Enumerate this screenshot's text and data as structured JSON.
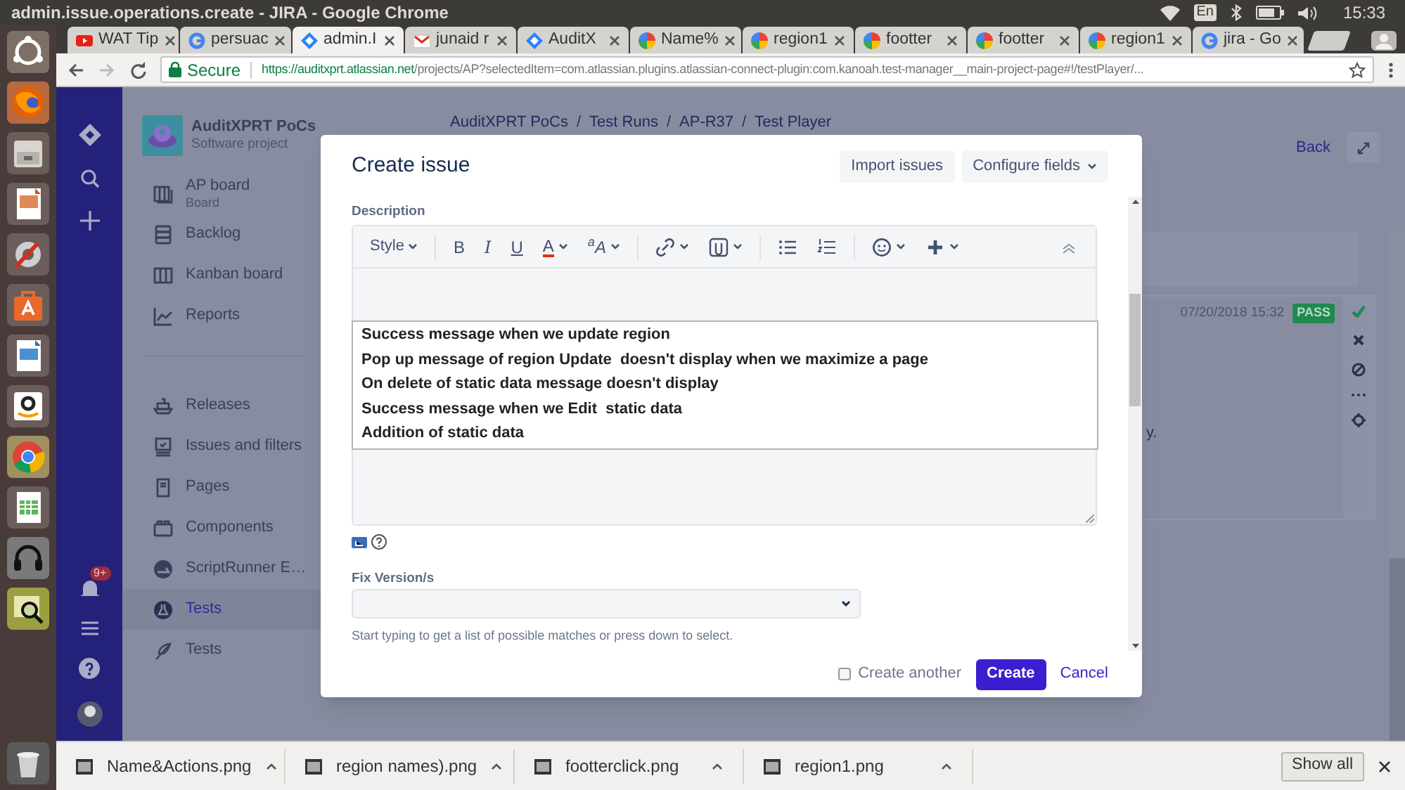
{
  "window": {
    "title": "admin.issue.operations.create - JIRA - Google Chrome"
  },
  "system_tray": {
    "language": "En",
    "time": "15:33"
  },
  "launcher": [
    {
      "kind": "ubuntu"
    },
    {
      "kind": "firefox"
    },
    {
      "kind": "files"
    },
    {
      "kind": "impress"
    },
    {
      "kind": "settings"
    },
    {
      "kind": "software"
    },
    {
      "kind": "writer"
    },
    {
      "kind": "amazon"
    },
    {
      "kind": "chrome"
    },
    {
      "kind": "calc"
    },
    {
      "kind": "headphones"
    },
    {
      "kind": "viewer"
    },
    {
      "kind": "trash"
    }
  ],
  "browser": {
    "tabs": [
      {
        "title": "WAT Tip",
        "kind": "video",
        "selected": false
      },
      {
        "title": "persuac",
        "kind": "search",
        "selected": false
      },
      {
        "title": "admin.I",
        "kind": "jira",
        "selected": true
      },
      {
        "title": "junaid r",
        "kind": "mail",
        "selected": false
      },
      {
        "title": "AuditX",
        "kind": "jira",
        "selected": false
      },
      {
        "title": "Name%",
        "kind": "drive",
        "selected": false
      },
      {
        "title": "region1",
        "kind": "drive",
        "selected": false
      },
      {
        "title": "footter",
        "kind": "drive",
        "selected": false
      },
      {
        "title": "footter",
        "kind": "drive",
        "selected": false
      },
      {
        "title": "region1",
        "kind": "drive",
        "selected": false
      },
      {
        "title": "jira - Go",
        "kind": "search",
        "selected": false
      }
    ],
    "address": {
      "secure_label": "Secure",
      "url_host": "https://auditxprt.atlassian.net",
      "url_path": "/projects/AP?selectedItem=com.atlassian.plugins.atlassian-connect-plugin:com.kanoah.test-manager__main-project-page#!/testPlayer/..."
    }
  },
  "jira": {
    "notification_badge": "9+",
    "project": {
      "name": "AuditXPRT PoCs",
      "type": "Software project"
    },
    "nav_groups": [
      {
        "items": [
          {
            "label": "AP board",
            "sublabel": "Board",
            "kind": "board",
            "selected": false
          },
          {
            "label": "Backlog",
            "kind": "backlog",
            "selected": false
          },
          {
            "label": "Kanban board",
            "kind": "columns",
            "selected": false
          },
          {
            "label": "Reports",
            "kind": "chart",
            "selected": false
          }
        ]
      },
      {
        "items": [
          {
            "label": "Releases",
            "kind": "ship",
            "selected": false
          },
          {
            "label": "Issues and filters",
            "kind": "monitor",
            "selected": false
          },
          {
            "label": "Pages",
            "kind": "page",
            "selected": false
          },
          {
            "label": "Components",
            "kind": "components",
            "selected": false
          },
          {
            "label": "ScriptRunner E…",
            "kind": "runner",
            "selected": false
          },
          {
            "label": "Tests",
            "kind": "flask",
            "selected": true
          },
          {
            "label": "Tests",
            "kind": "feather",
            "selected": false
          }
        ]
      }
    ],
    "breadcrumbs": [
      {
        "kind": "link",
        "text": "AuditXPRT PoCs"
      },
      {
        "kind": "separator",
        "text": "/"
      },
      {
        "kind": "link",
        "text": "Test Runs"
      },
      {
        "kind": "separator",
        "text": "/"
      },
      {
        "kind": "link",
        "text": "AP-R37"
      },
      {
        "kind": "separator",
        "text": "/"
      },
      {
        "kind": "link",
        "text": "Test Player"
      }
    ],
    "back_link": "Back",
    "test_result": {
      "timestamp": "07/20/2018 15:32",
      "status": "PASS",
      "text_fragment": "y."
    }
  },
  "dialog": {
    "title": "Create issue",
    "header_buttons": [
      {
        "label": "Import issues",
        "dropdown": false
      },
      {
        "label": "Configure fields",
        "dropdown": true
      }
    ],
    "description": {
      "label": "Description",
      "toolbar": [
        {
          "kind": "style",
          "label": "Style",
          "dropdown": true
        },
        {
          "kind": "separator"
        },
        {
          "kind": "bold",
          "label": "B",
          "dropdown": false
        },
        {
          "kind": "italic",
          "label": "I",
          "dropdown": false
        },
        {
          "kind": "underline",
          "label": "U",
          "dropdown": false
        },
        {
          "kind": "color",
          "label": "A",
          "dropdown": true
        },
        {
          "kind": "text_size",
          "label": "$^{a}$A",
          "dropdown": true
        },
        {
          "kind": "separator"
        },
        {
          "kind": "link",
          "dropdown": true
        },
        {
          "kind": "attachment",
          "dropdown": true
        },
        {
          "kind": "separator"
        },
        {
          "kind": "bullet_list",
          "dropdown": false
        },
        {
          "kind": "numbered_list",
          "dropdown": false
        },
        {
          "kind": "separator"
        },
        {
          "kind": "emoji",
          "dropdown": true
        },
        {
          "kind": "insert",
          "dropdown": true
        },
        {
          "kind": "collapse",
          "dropdown": false
        }
      ],
      "suggestions": [
        "Success message when we update region",
        "Pop up message of region Update  doesn't display when we maximize a page",
        "On delete of static data message doesn't display",
        "Success message when we Edit  static data",
        "Addition of static data"
      ]
    },
    "fix_version": {
      "label": "Fix Version/s",
      "help": "Start typing to get a list of possible matches or press down to select."
    },
    "create_another": {
      "label": "Create another",
      "checked": false
    },
    "create_button": "Create",
    "cancel_link": "Cancel"
  },
  "downloads": {
    "items": [
      "Name&Actions.png",
      "region names).png",
      "footterclick.png",
      "region1.png"
    ],
    "show_all": "Show all"
  }
}
